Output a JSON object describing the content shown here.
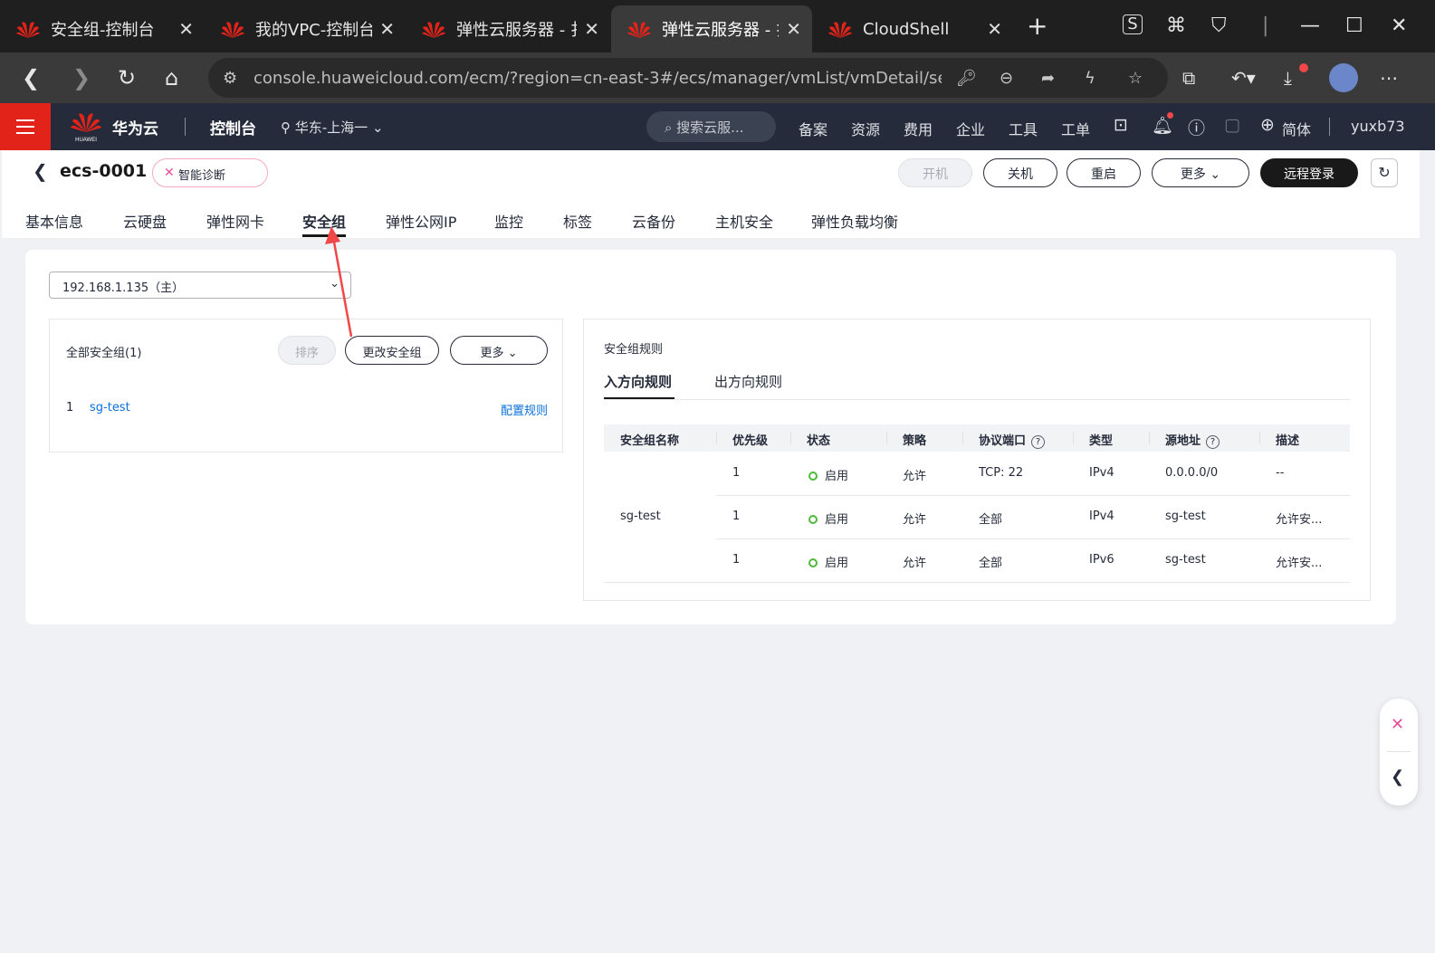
{
  "browser": {
    "tabs": [
      {
        "title": "安全组-控制台",
        "active": false
      },
      {
        "title": "我的VPC-控制台",
        "active": false
      },
      {
        "title": "弹性云服务器 - 扌",
        "active": false
      },
      {
        "title": "弹性云服务器 - 扌",
        "active": true
      },
      {
        "title": "CloudShell",
        "active": false
      }
    ],
    "new_tab": "+",
    "url": "console.huaweicloud.com/ecm/?region=cn-east-3#/ecs/manager/vmList/vmDetail/sec..."
  },
  "header": {
    "logo_text": "HUAWEI",
    "brand": "华为云",
    "console": "控制台",
    "region": "华东-上海一",
    "search_placeholder": "搜索云服...",
    "nav": [
      "备案",
      "资源",
      "费用",
      "企业",
      "工具",
      "工单"
    ],
    "language": "简体",
    "user": "yuxb73"
  },
  "page": {
    "name": "ecs-0001",
    "diagnose": "智能诊断",
    "buttons": {
      "start": "开机",
      "shutdown": "关机",
      "restart": "重启",
      "more": "更多",
      "remote_login": "远程登录"
    },
    "tabs": [
      "基本信息",
      "云硬盘",
      "弹性网卡",
      "安全组",
      "弹性公网IP",
      "监控",
      "标签",
      "云备份",
      "主机安全",
      "弹性负载均衡"
    ],
    "active_tab": "安全组"
  },
  "security": {
    "nic_select": "192.168.1.135（主）",
    "all_groups_label": "全部安全组(1)",
    "sort_button": "排序",
    "change_button": "更改安全组",
    "more_button": "更多",
    "groups": [
      {
        "index": "1",
        "name": "sg-test",
        "configure": "配置规则"
      }
    ],
    "rules": {
      "title": "安全组规则",
      "inbound_tab": "入方向规则",
      "outbound_tab": "出方向规则",
      "columns": [
        "安全组名称",
        "优先级",
        "状态",
        "策略",
        "协议端口",
        "类型",
        "源地址",
        "描述"
      ],
      "group_name": "sg-test",
      "rows": [
        {
          "priority": "1",
          "status": "启用",
          "policy": "允许",
          "port": "TCP: 22",
          "type": "IPv4",
          "source": "0.0.0.0/0",
          "desc": "--"
        },
        {
          "priority": "1",
          "status": "启用",
          "policy": "允许",
          "port": "全部",
          "type": "IPv4",
          "source": "sg-test",
          "desc": "允许安..."
        },
        {
          "priority": "1",
          "status": "启用",
          "policy": "允许",
          "port": "全部",
          "type": "IPv6",
          "source": "sg-test",
          "desc": "允许安..."
        }
      ]
    }
  },
  "colors": {
    "header_bg": "#252b3a",
    "brand_red": "#e2231a",
    "link": "#0a6fd8",
    "status_green": "#50b83c",
    "annotation_arrow": "#f04848"
  }
}
